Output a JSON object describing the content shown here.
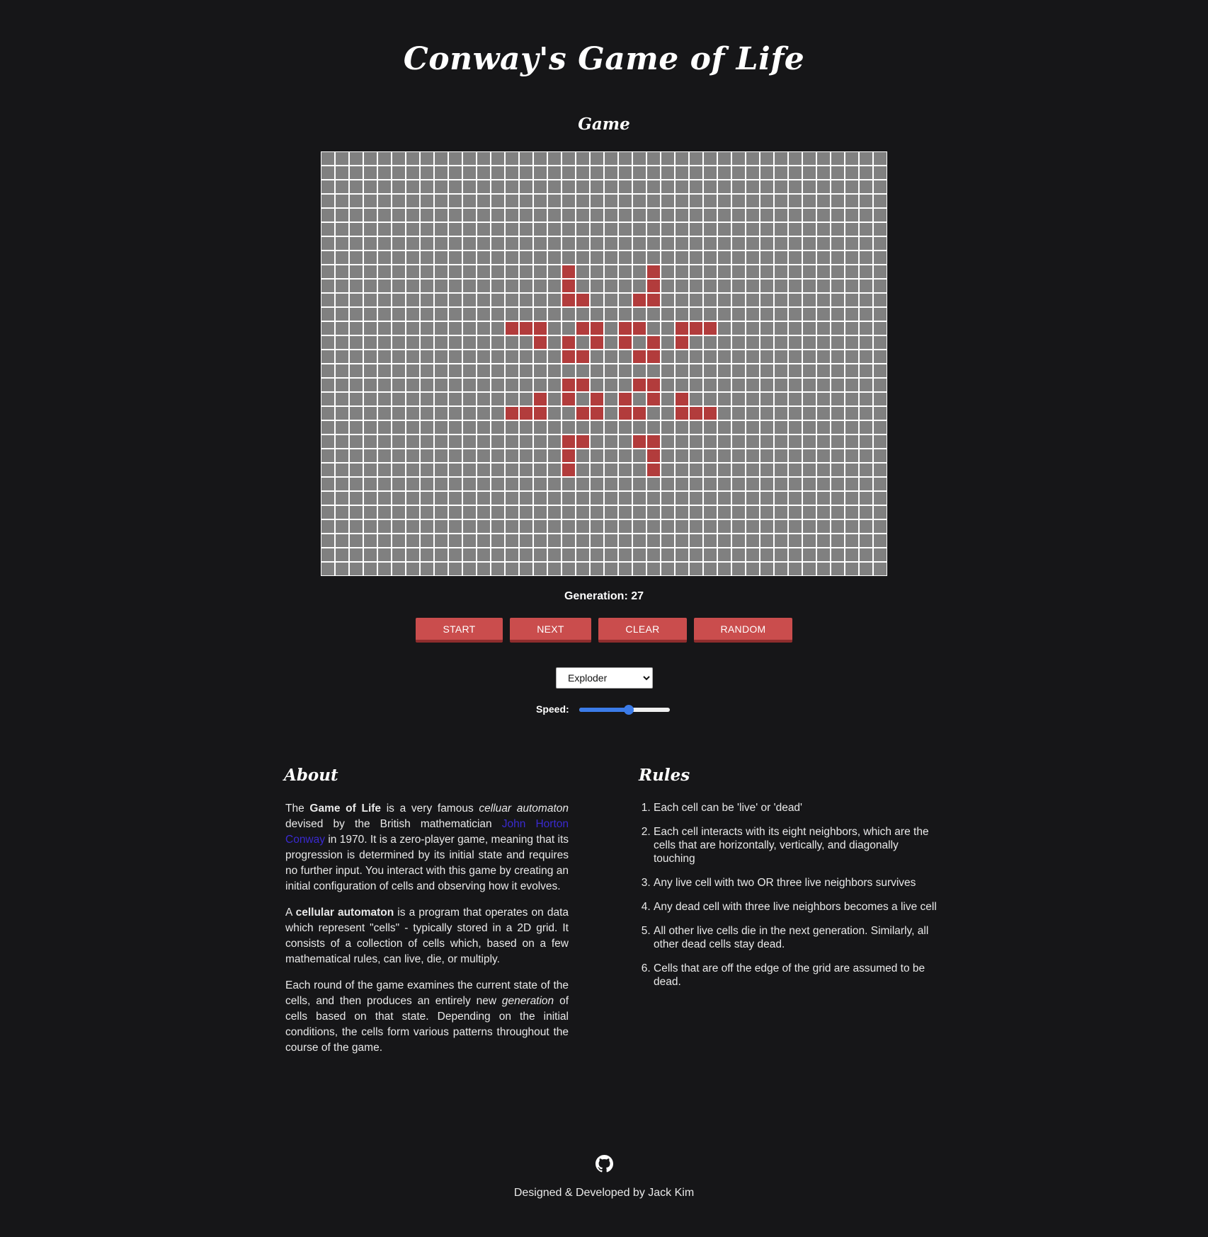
{
  "header": {
    "title": "Conway's Game of Life"
  },
  "game": {
    "heading": "Game",
    "grid": {
      "rows": 30,
      "cols": 40,
      "alive_cells": [
        [
          8,
          17
        ],
        [
          8,
          23
        ],
        [
          9,
          17
        ],
        [
          9,
          23
        ],
        [
          10,
          17
        ],
        [
          10,
          18
        ],
        [
          10,
          22
        ],
        [
          10,
          23
        ],
        [
          12,
          13
        ],
        [
          12,
          14
        ],
        [
          12,
          15
        ],
        [
          12,
          18
        ],
        [
          12,
          19
        ],
        [
          12,
          21
        ],
        [
          12,
          22
        ],
        [
          12,
          25
        ],
        [
          12,
          26
        ],
        [
          12,
          27
        ],
        [
          13,
          15
        ],
        [
          13,
          17
        ],
        [
          13,
          19
        ],
        [
          13,
          21
        ],
        [
          13,
          23
        ],
        [
          13,
          25
        ],
        [
          14,
          17
        ],
        [
          14,
          18
        ],
        [
          14,
          22
        ],
        [
          14,
          23
        ],
        [
          16,
          17
        ],
        [
          16,
          18
        ],
        [
          16,
          22
        ],
        [
          16,
          23
        ],
        [
          17,
          15
        ],
        [
          17,
          17
        ],
        [
          17,
          19
        ],
        [
          17,
          21
        ],
        [
          17,
          23
        ],
        [
          17,
          25
        ],
        [
          18,
          13
        ],
        [
          18,
          14
        ],
        [
          18,
          15
        ],
        [
          18,
          18
        ],
        [
          18,
          19
        ],
        [
          18,
          21
        ],
        [
          18,
          22
        ],
        [
          18,
          25
        ],
        [
          18,
          26
        ],
        [
          18,
          27
        ],
        [
          20,
          17
        ],
        [
          20,
          18
        ],
        [
          20,
          22
        ],
        [
          20,
          23
        ],
        [
          21,
          17
        ],
        [
          21,
          23
        ],
        [
          22,
          17
        ],
        [
          22,
          23
        ]
      ],
      "colors": {
        "alive": "#b23c3c",
        "dead": "#808080",
        "gridline": "#ffffff"
      }
    },
    "generation_label": "Generation: 27",
    "buttons": {
      "start": "START",
      "next": "NEXT",
      "clear": "CLEAR",
      "random": "RANDOM"
    },
    "pattern_select": {
      "selected": "Exploder"
    },
    "speed": {
      "label": "Speed:",
      "value_percent": 55
    }
  },
  "about": {
    "heading": "About",
    "p1": {
      "t1": "The ",
      "b1": "Game of Life",
      "t2": " is a very famous ",
      "i1": "celluar automaton",
      "t3": " devised by the British mathematician ",
      "link": "John Horton Conway",
      "t4": " in 1970. It is a zero-player game, meaning that its progression is determined by its initial state and requires no further input. You interact with this game by creating an initial configuration of cells and observing how it evolves."
    },
    "p2": {
      "t1": "A ",
      "b1": "cellular automaton",
      "t2": " is a program that operates on data which represent \"cells\" - typically stored in a 2D grid. It consists of a collection of cells which, based on a few mathematical rules, can live, die, or multiply."
    },
    "p3": {
      "t1": "Each round of the game examines the current state of the cells, and then produces an entirely new ",
      "i1": "generation",
      "t2": " of cells based on that state. Depending on the initial conditions, the cells form various patterns throughout the course of the game."
    }
  },
  "rules": {
    "heading": "Rules",
    "items": [
      "Each cell can be 'live' or 'dead'",
      "Each cell interacts with its eight neighbors, which are the cells that are horizontally, vertically, and diagonally touching",
      "Any live cell with two OR three live neighbors survives",
      "Any dead cell with three live neighbors becomes a live cell",
      "All other live cells die in the next generation. Similarly, all other dead cells stay dead.",
      "Cells that are off the edge of the grid are assumed to be dead."
    ]
  },
  "footer": {
    "icon": "github-icon",
    "credit": "Designed & Developed by Jack Kim"
  }
}
